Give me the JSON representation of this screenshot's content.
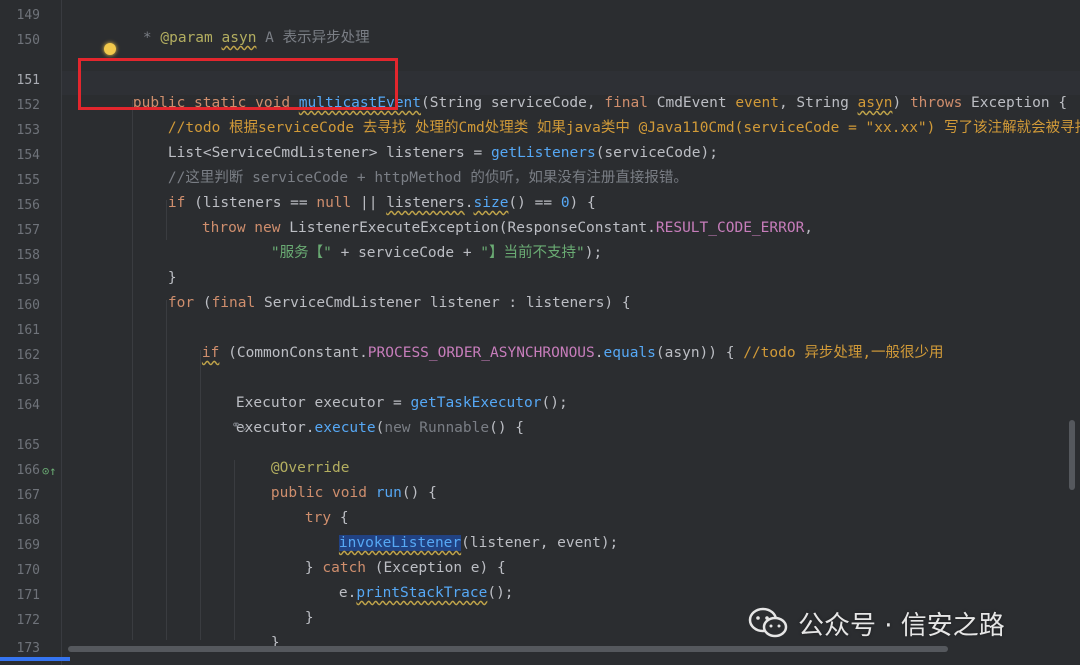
{
  "line_numbers": [
    "149",
    "150",
    "151",
    "152",
    "153",
    "154",
    "155",
    "156",
    "157",
    "158",
    "159",
    "160",
    "161",
    "162",
    "163",
    "164",
    "165",
    "166",
    "167",
    "168",
    "169",
    "170",
    "171",
    "172",
    "173"
  ],
  "watermark": {
    "text": "公众号 · 信安之路"
  },
  "code": {
    "l149": {
      "star": "* ",
      "tag": "@param",
      "name": "asyn",
      "desc": " A 表示异步处理"
    },
    "l151": {
      "kw1": "public static void ",
      "fn": "multicastEvent",
      "p1": "(String serviceCode, ",
      "kw2": "final ",
      "p2": "CmdEvent ",
      "pv1": "event",
      "p3": ", String ",
      "pv2": "asyn",
      "p4": ") ",
      "kw3": "throws ",
      "p5": "Exception {"
    },
    "l152": {
      "text": "//todo 根据serviceCode 去寻找 处理的Cmd处理类 如果java类中 @Java110Cmd(serviceCode = \"xx.xx\") 写了该注解就会被寻找到"
    },
    "l153": {
      "a": "List<ServiceCmdListener> listeners = ",
      "fn": "getListeners",
      "b": "(serviceCode);"
    },
    "l154": {
      "text": "//这里判断 serviceCode + httpMethod 的侦听，如果没有注册直接报错。"
    },
    "l155": {
      "kw": "if ",
      "a": "(listeners == ",
      "kw2": "null",
      "b": " || ",
      "c": "listeners",
      "d": ".",
      "fn": "size",
      "e": "() == ",
      "num": "0",
      "f": ") {"
    },
    "l156": {
      "kw": "throw new ",
      "a": "ListenerExecuteException(ResponseConstant.",
      "const": "RESULT_CODE_ERROR",
      "b": ","
    },
    "l157": {
      "str1": "\"服务【\"",
      "a": " + serviceCode + ",
      "str2": "\"】当前不支持\"",
      "b": ");"
    },
    "l158": {
      "text": "}"
    },
    "l159": {
      "kw": "for ",
      "a": "(",
      "kw2": "final ",
      "b": "ServiceCmdListener listener : listeners) {"
    },
    "l161": {
      "kw": "if",
      "a": " (CommonConstant.",
      "const": "PROCESS_ORDER_ASYNCHRONOUS",
      "b": ".",
      "fn": "equals",
      "c": "(asyn)) { ",
      "todo": "//todo 异步处理,一般很少用"
    },
    "l163": {
      "a": "Executor executor = ",
      "fn": "getTaskExecutor",
      "b": "();"
    },
    "l164": {
      "a": "executor.",
      "fn": "execute",
      "b": "(",
      "kw": "new ",
      "c": "Runnable",
      "d": "() {"
    },
    "l164b": {
      "text": "⚭⌄"
    },
    "l165": {
      "text": "@Override"
    },
    "l166": {
      "kw": "public void ",
      "fn": "run",
      "a": "() {"
    },
    "l167": {
      "kw": "try ",
      "a": "{"
    },
    "l168": {
      "fn": "invokeListener",
      "a": "(listener, event);"
    },
    "l169": {
      "a": "} ",
      "kw": "catch ",
      "b": "(Exception e) {"
    },
    "l170": {
      "a": "e.",
      "fn": "printStackTrace",
      "b": "();"
    },
    "l171": {
      "text": "}"
    },
    "l172": {
      "text": "}"
    }
  }
}
